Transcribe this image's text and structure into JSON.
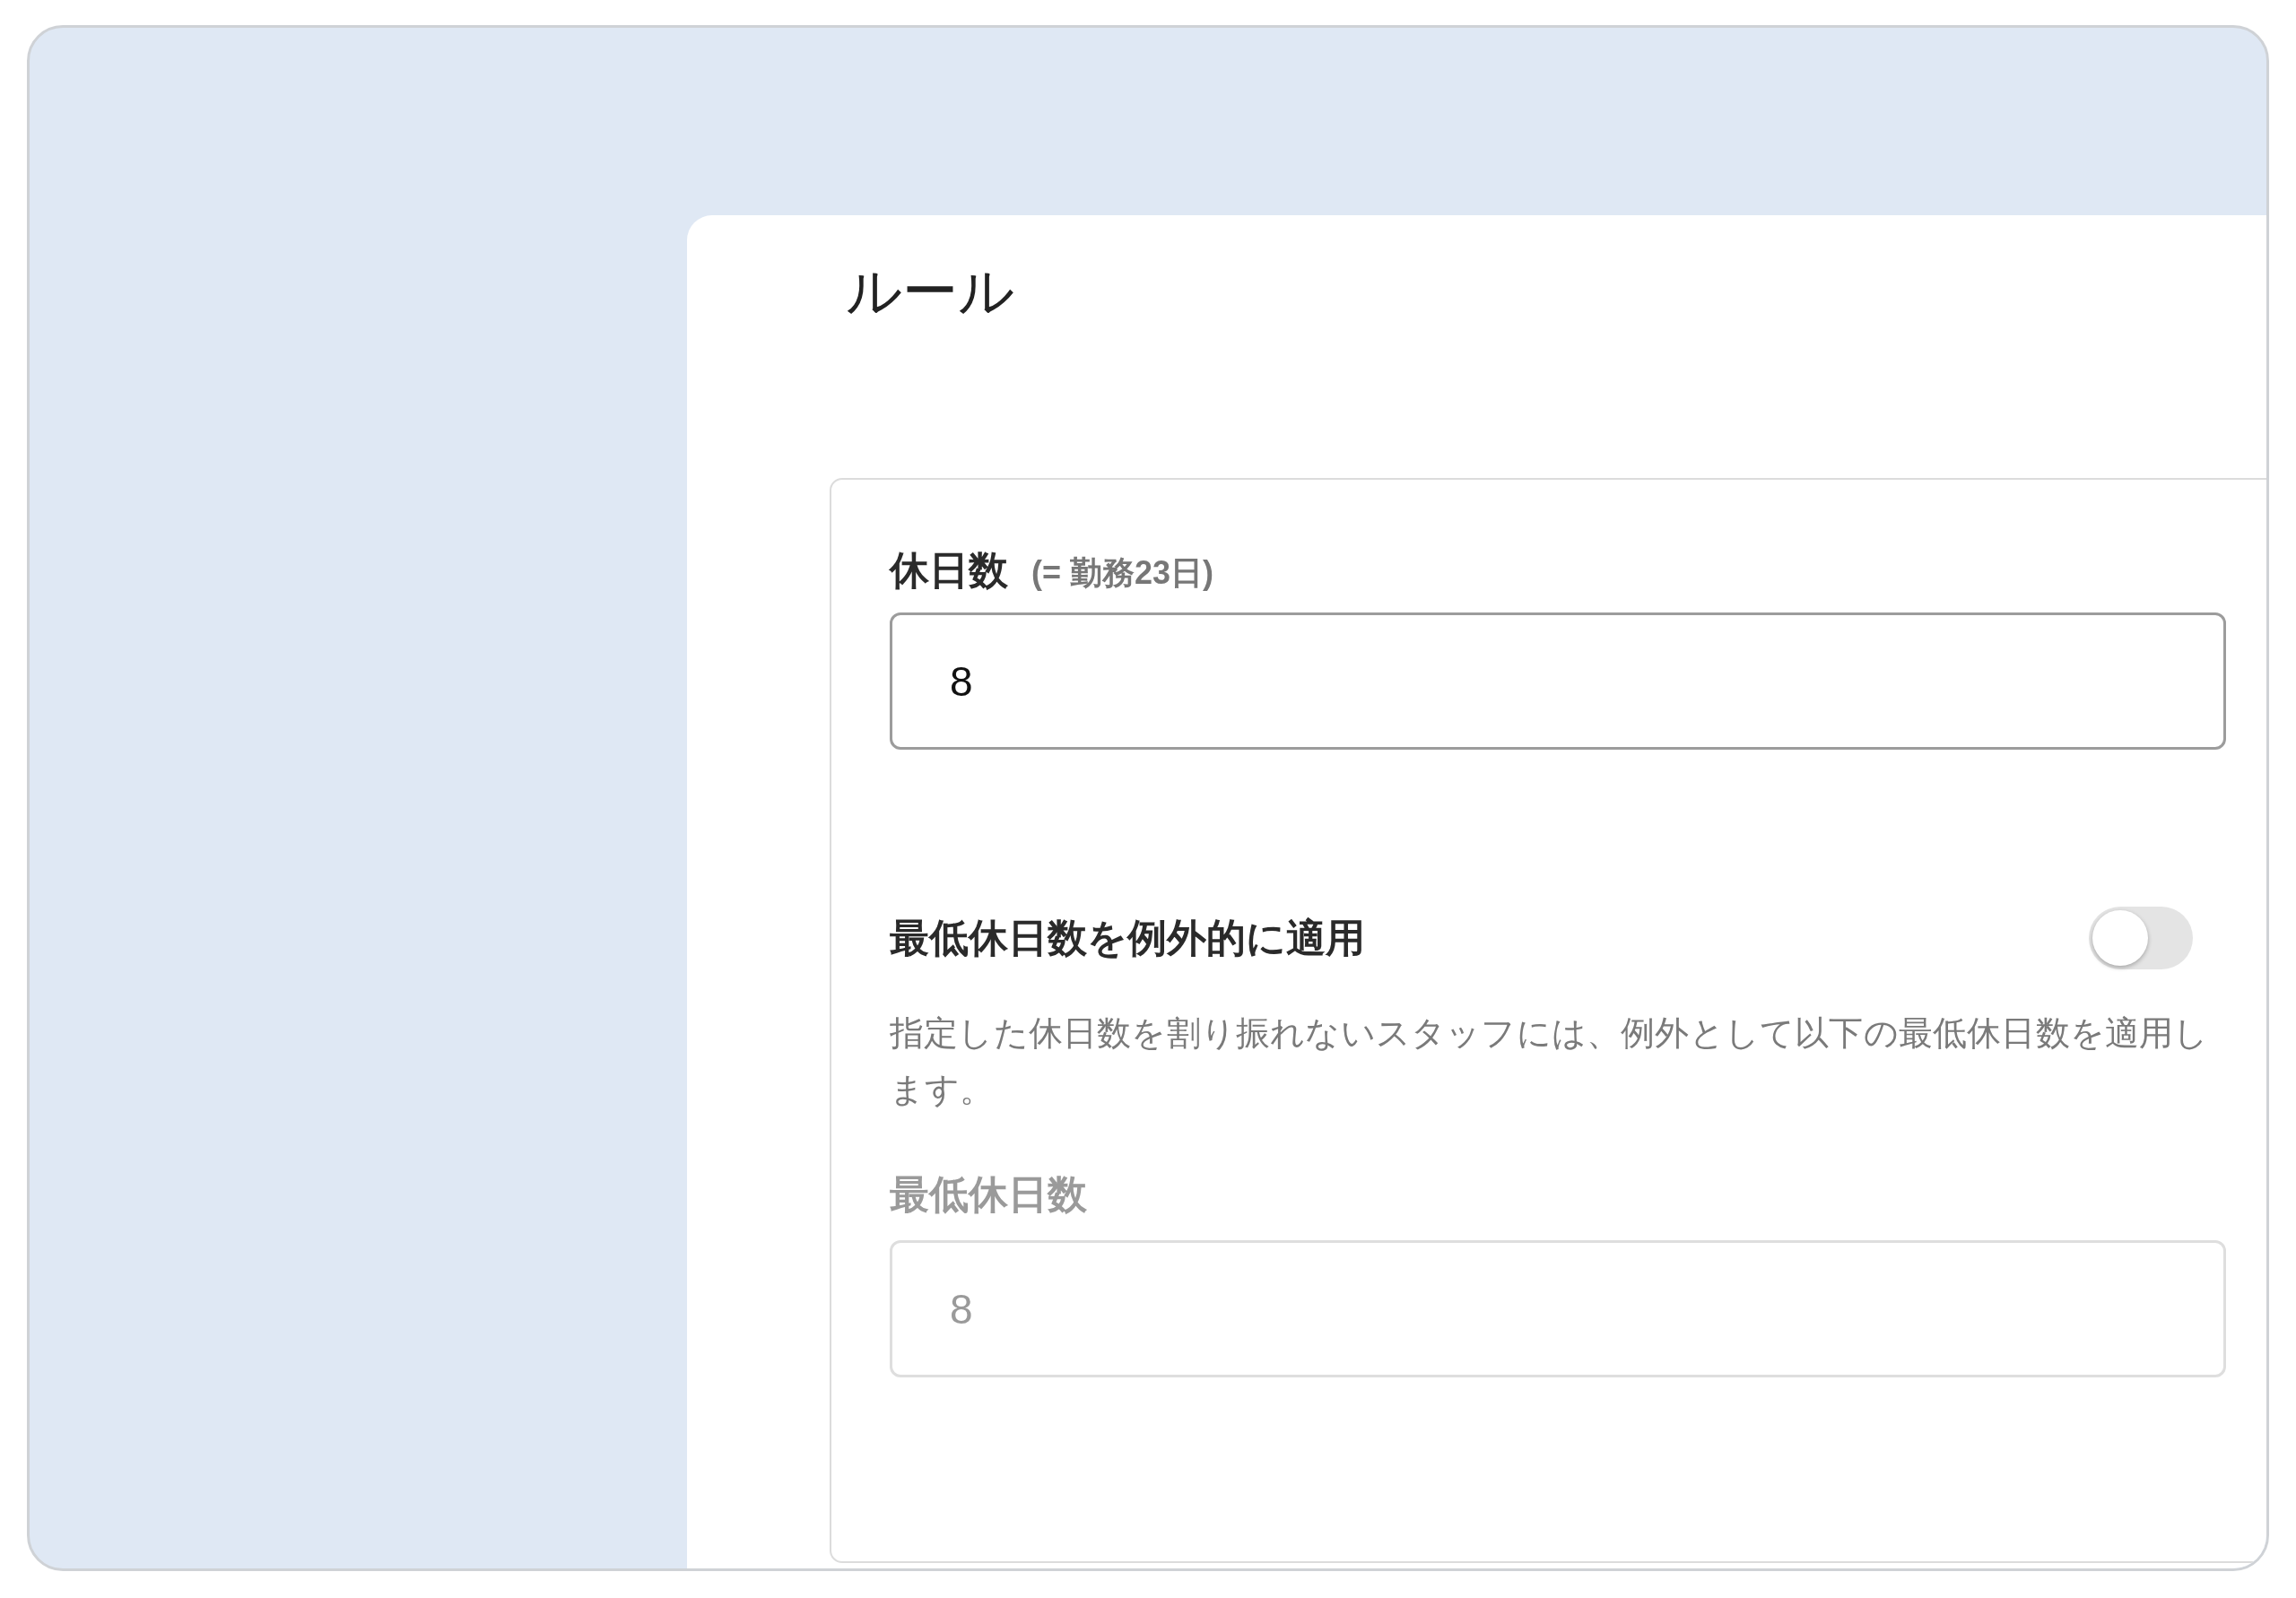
{
  "panel": {
    "title": "ルール"
  },
  "holidays": {
    "label": "休日数",
    "note": "(= 勤務23日)",
    "value": "8"
  },
  "exception": {
    "label": "最低休日数を例外的に適用",
    "on": false,
    "description": "指定した休日数を割り振れないスタッフには、例外として以下の最低休日数を適用します。"
  },
  "minimum": {
    "label": "最低休日数",
    "value": "8",
    "disabled": true
  }
}
